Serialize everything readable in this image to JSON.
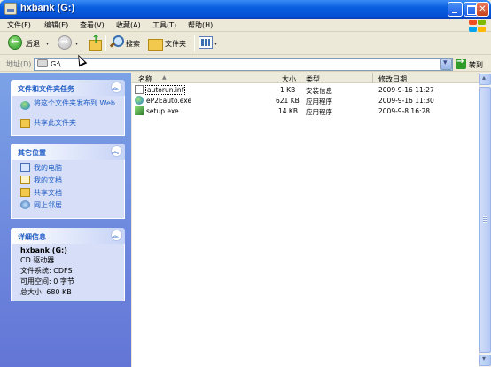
{
  "window": {
    "title": "hxbank (G:)"
  },
  "menu": [
    "文件(F)",
    "编辑(E)",
    "查看(V)",
    "收藏(A)",
    "工具(T)",
    "帮助(H)"
  ],
  "toolbar": {
    "back": "后退",
    "search": "搜索",
    "folders": "文件夹"
  },
  "address": {
    "label": "地址(D)",
    "value": "G:\\",
    "go": "转到"
  },
  "tasks": {
    "title": "文件和文件夹任务",
    "items": [
      {
        "label": "将这个文件夹发布到 Web",
        "icon": "web-publish-icon"
      },
      {
        "label": "共享此文件夹",
        "icon": "share-folder-icon"
      }
    ]
  },
  "other_places": {
    "title": "其它位置",
    "items": [
      {
        "label": "我的电脑",
        "icon": "my-computer-icon"
      },
      {
        "label": "我的文档",
        "icon": "my-documents-icon"
      },
      {
        "label": "共享文档",
        "icon": "shared-documents-icon"
      },
      {
        "label": "网上邻居",
        "icon": "network-places-icon"
      }
    ]
  },
  "details": {
    "title": "详细信息",
    "name": "hxbank (G:)",
    "type": "CD 驱动器",
    "fs": "文件系统: CDFS",
    "free": "可用空间: 0 字节",
    "total": "总大小: 680 KB"
  },
  "columns": {
    "name": "名称",
    "size": "大小",
    "type": "类型",
    "modified": "修改日期"
  },
  "files": [
    {
      "name": "autorun.inf",
      "size": "1 KB",
      "type": "安装信息",
      "modified": "2009-9-16 11:27",
      "icon": "inf-file-icon"
    },
    {
      "name": "eP2Eauto.exe",
      "size": "621 KB",
      "type": "应用程序",
      "modified": "2009-9-16 11:30",
      "icon": "exe-file-icon"
    },
    {
      "name": "setup.exe",
      "size": "14 KB",
      "type": "应用程序",
      "modified": "2009-9-8 16:28",
      "icon": "setup-exe-icon"
    }
  ],
  "colors": {
    "title_bar": "#0a5fe0",
    "task_pane": "#6f8de0",
    "link": "#215dc6"
  }
}
